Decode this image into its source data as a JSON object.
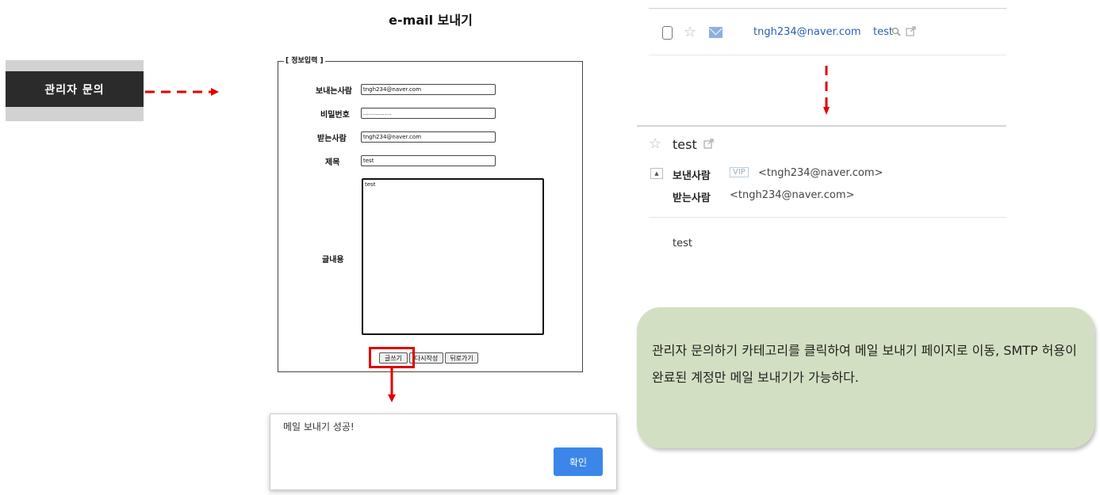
{
  "admin_menu": {
    "label": "관리자 문의"
  },
  "form": {
    "title": "e-mail 보내기",
    "legend": "[ 정보입력 ]",
    "sender_label": "보내는사람",
    "sender_value": "tngh234@naver.com",
    "password_label": "비밀번호",
    "password_value": "................",
    "recipient_label": "받는사람",
    "recipient_value": "tngh234@naver.com",
    "subject_label": "제목",
    "subject_value": "test",
    "content_label": "글내용",
    "content_value": "test",
    "buttons": {
      "write": "글쓰기",
      "rewrite": "다시작성",
      "back": "뒤로가기"
    }
  },
  "dialog": {
    "message": "메일 보내기 성공!",
    "ok": "확인"
  },
  "mail_list": {
    "sender": "tngh234@naver.com",
    "subject": "test"
  },
  "mail_detail": {
    "subject": "test",
    "from_label": "보낸사람",
    "vip": "VIP",
    "from_addr": "<tngh234@naver.com>",
    "to_label": "받는사람",
    "to_addr": "<tngh234@naver.com>",
    "body": "test"
  },
  "note": {
    "text": "관리자 문의하기 카테고리를 클릭하여 메일 보내기 페이지로 이동, SMTP 허용이 완료된 계정만 메일 보내기가 가능하다."
  },
  "colors": {
    "arrow": "#e00000",
    "note_bg": "#d3dfc2",
    "ok_button": "#3b86e8"
  },
  "icons": [
    "checkbox-icon",
    "star-icon",
    "envelope-icon",
    "search-icon",
    "external-link-icon",
    "collapse-icon"
  ]
}
